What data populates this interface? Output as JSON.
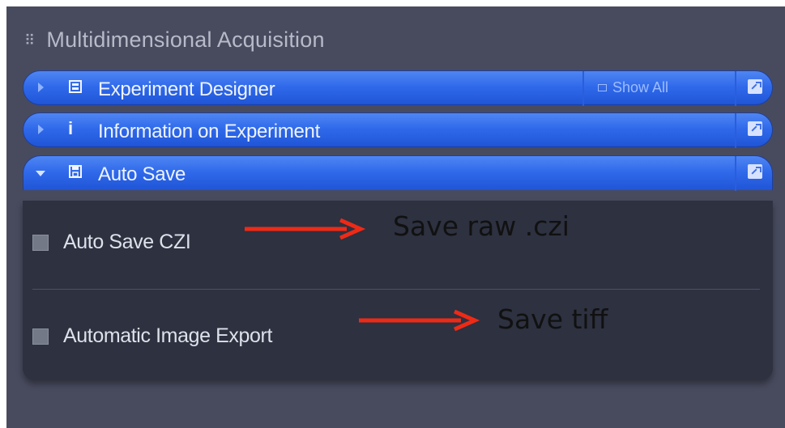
{
  "panel": {
    "title": "Multidimensional Acquisition",
    "grip_icon": "drag-handle-icon",
    "sections": [
      {
        "label": "Experiment Designer",
        "icon": "experiment-designer-icon",
        "show_all": "Show All",
        "expanded": false
      },
      {
        "label": "Information on Experiment",
        "icon": "info-icon",
        "expanded": false
      },
      {
        "label": "Auto Save",
        "icon": "floppy-disk-icon",
        "expanded": true
      }
    ]
  },
  "auto_save": {
    "option_czi": "Auto Save CZI",
    "option_export": "Automatic Image Export",
    "checked_czi": false,
    "checked_export": false
  },
  "annotations": {
    "note_czi": "Save raw .czi",
    "note_tiff": "Save tiff",
    "arrow_color": "#ee2a16"
  },
  "colors": {
    "panel_bg": "#484b5e",
    "section_blue": "#2f69ea",
    "content_bg": "#2d3140"
  }
}
